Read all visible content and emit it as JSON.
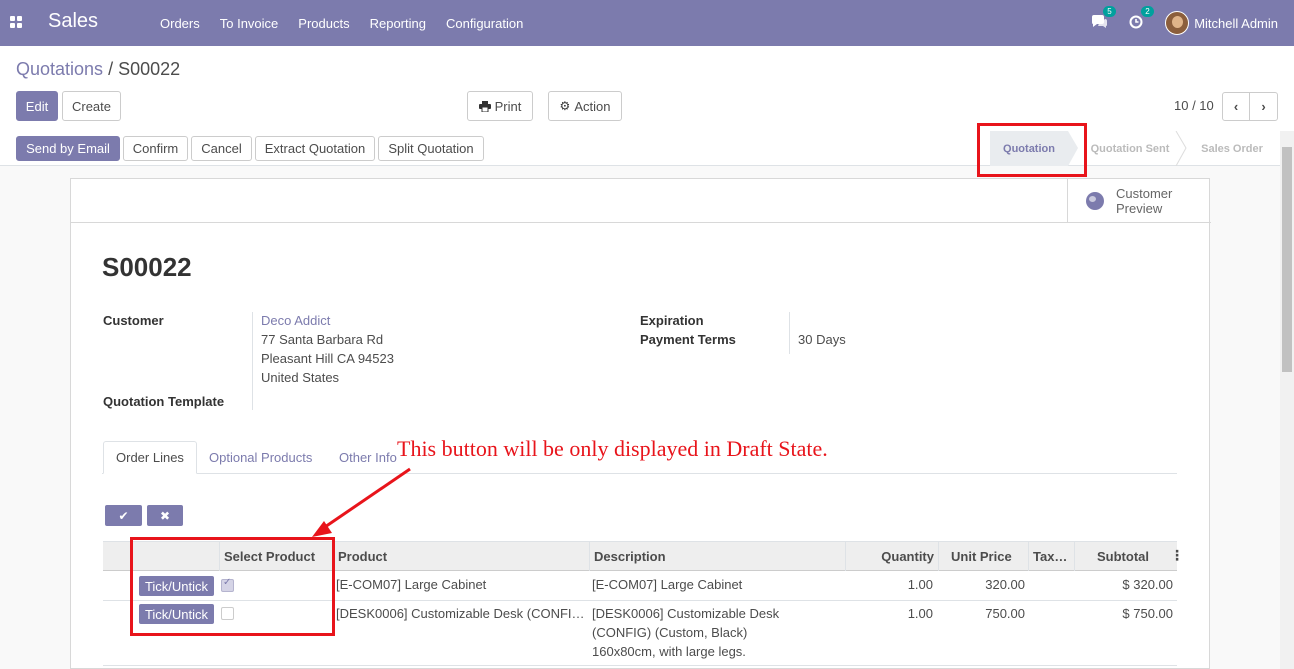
{
  "navbar": {
    "app_name": "Sales",
    "menu": [
      "Orders",
      "To Invoice",
      "Products",
      "Reporting",
      "Configuration"
    ],
    "messages_count": "5",
    "activities_count": "2",
    "user_name": "Mitchell Admin",
    "bg_color": "#7c7bad"
  },
  "breadcrumb": {
    "parent": "Quotations",
    "separator": "/",
    "current": "S00022"
  },
  "control": {
    "edit": "Edit",
    "create": "Create",
    "print": "Print",
    "action": "Action",
    "pager": "10 / 10"
  },
  "statusbar": {
    "buttons": [
      "Send by Email",
      "Confirm",
      "Cancel",
      "Extract Quotation",
      "Split Quotation"
    ],
    "stages": [
      "Quotation",
      "Quotation Sent",
      "Sales Order"
    ],
    "active_stage": "Quotation"
  },
  "smart_button": {
    "label_line1": "Customer",
    "label_line2": "Preview"
  },
  "form": {
    "title": "S00022",
    "customer_label": "Customer",
    "customer_name": "Deco Addict",
    "address_line1": "77 Santa Barbara Rd",
    "address_line2": "Pleasant Hill CA 94523",
    "address_line3": "United States",
    "template_label": "Quotation Template",
    "expiration_label": "Expiration",
    "payment_terms_label": "Payment Terms",
    "payment_terms": "30 Days"
  },
  "tabs": [
    "Order Lines",
    "Optional Products",
    "Other Info"
  ],
  "annotation": "This button will be only displayed in Draft State.",
  "table": {
    "headers": [
      "Select Product",
      "Product",
      "Description",
      "Quantity",
      "Unit Price",
      "Tax…",
      "Subtotal"
    ],
    "rows": [
      {
        "button": "Tick/Untick",
        "checked": true,
        "product": "[E-COM07] Large Cabinet",
        "description": "[E-COM07] Large Cabinet",
        "quantity": "1.00",
        "unit_price": "320.00",
        "subtotal": "$ 320.00"
      },
      {
        "button": "Tick/Untick",
        "checked": false,
        "product": "[DESK0006] Customizable Desk (CONFI…",
        "description_line1": "[DESK0006] Customizable Desk",
        "description_line2": "(CONFIG) (Custom, Black)",
        "description_line3": "160x80cm, with large legs.",
        "quantity": "1.00",
        "unit_price": "750.00",
        "subtotal": "$ 750.00"
      }
    ]
  },
  "colors": {
    "accent": "#7c7bad",
    "annotation_red": "#e8141b"
  }
}
